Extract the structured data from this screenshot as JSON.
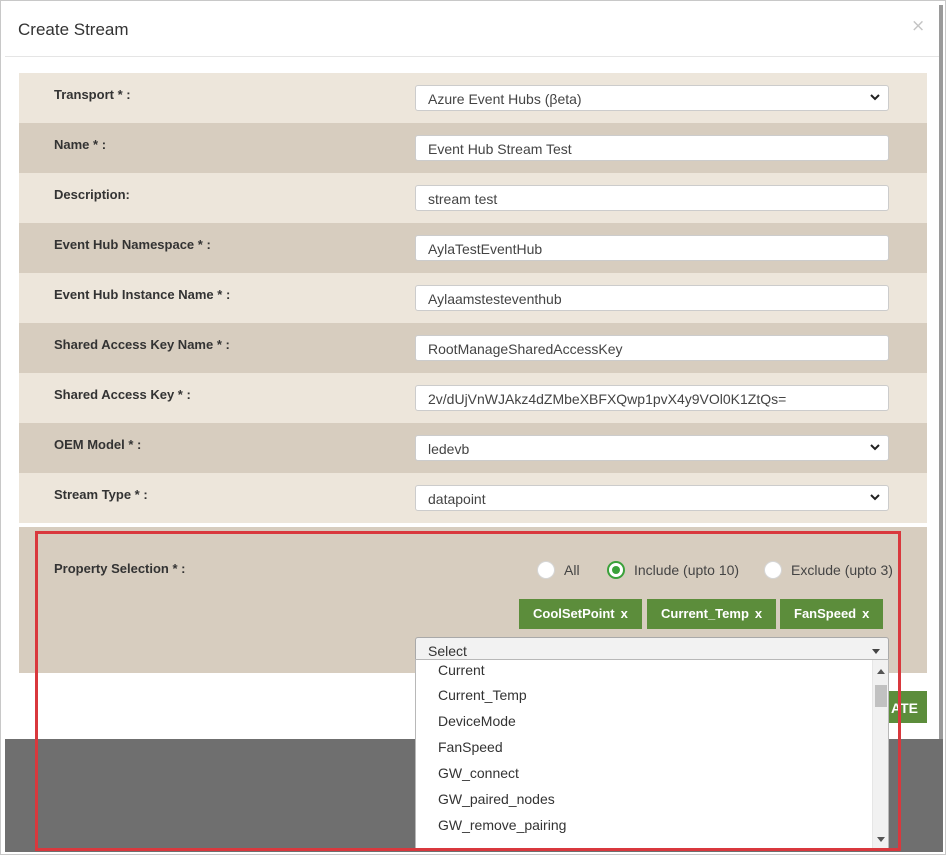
{
  "modal": {
    "title": "Create Stream",
    "close_glyph": "×",
    "create_button_label": "ATE"
  },
  "form": {
    "transport": {
      "label": "Transport * :",
      "value": "Azure Event Hubs (βeta)"
    },
    "name": {
      "label": "Name * :",
      "value": "Event Hub Stream Test"
    },
    "description": {
      "label": "Description:",
      "value": "stream test"
    },
    "namespace": {
      "label": "Event Hub Namespace * :",
      "value": "AylaTestEventHub"
    },
    "instance": {
      "label": "Event Hub Instance Name * :",
      "value": "Aylaamstesteventhub"
    },
    "key_name": {
      "label": "Shared Access Key Name * :",
      "value": "RootManageSharedAccessKey"
    },
    "key": {
      "label": "Shared Access Key * :",
      "value": "2v/dUjVnWJAkz4dZMbeXBFXQwp1pvX4y9VOl0K1ZtQs="
    },
    "oem_model": {
      "label": "OEM Model * :",
      "value": "ledevb"
    },
    "stream_type": {
      "label": "Stream Type * :",
      "value": "datapoint"
    }
  },
  "property_selection": {
    "label": "Property Selection * :",
    "radios": [
      {
        "label": "All",
        "checked": false
      },
      {
        "label": "Include (upto 10)",
        "checked": true
      },
      {
        "label": "Exclude (upto 3)",
        "checked": false
      }
    ],
    "tags": [
      "CoolSetPoint",
      "Current_Temp",
      "FanSpeed"
    ],
    "tag_remove_glyph": "x",
    "select_value": "Select",
    "options": [
      "Current",
      "Current_Temp",
      "DeviceMode",
      "FanSpeed",
      "GW_connect",
      "GW_paired_nodes",
      "GW_remove_pairing"
    ]
  },
  "colors": {
    "accent_green": "#5c8d3b",
    "row_light": "#ede6db",
    "row_dark": "#d7cdbf",
    "highlight_red": "#d9383d"
  },
  "icons": {
    "select_arrow": "chevron-down-icon",
    "close": "close-icon"
  }
}
